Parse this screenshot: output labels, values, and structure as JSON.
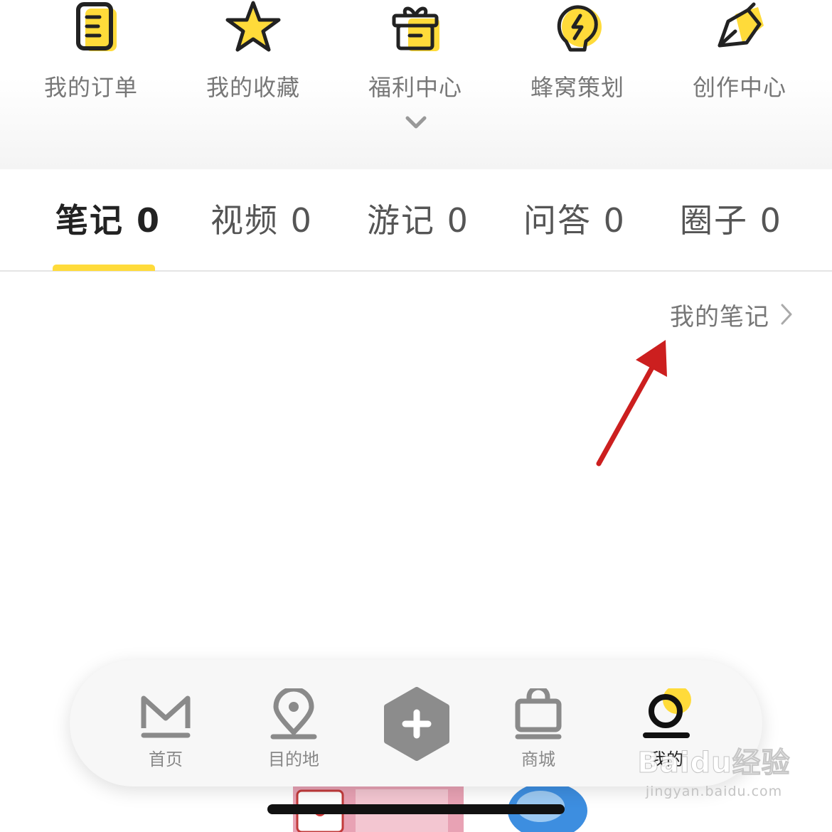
{
  "quick_menu": {
    "items": [
      {
        "label": "我的订单",
        "icon": "order-icon"
      },
      {
        "label": "我的收藏",
        "icon": "star-icon"
      },
      {
        "label": "福利中心",
        "icon": "gift-icon"
      },
      {
        "label": "蜂窝策划",
        "icon": "bulb-icon"
      },
      {
        "label": "创作中心",
        "icon": "pen-icon"
      }
    ],
    "expand_icon": "chevron-down-icon"
  },
  "tabs": [
    {
      "label": "笔记 0",
      "active": true
    },
    {
      "label": "视频 0",
      "active": false
    },
    {
      "label": "游记 0",
      "active": false
    },
    {
      "label": "问答 0",
      "active": false
    },
    {
      "label": "圈子 0",
      "active": false
    }
  ],
  "my_notes": {
    "label": "我的笔记",
    "icon": "chevron-right-icon"
  },
  "bottom_nav": {
    "items": [
      {
        "label": "首页",
        "icon": "home-m-icon",
        "active": false
      },
      {
        "label": "目的地",
        "icon": "location-pin-icon",
        "active": false
      },
      {
        "label": "商城",
        "icon": "shopping-bag-icon",
        "active": false
      },
      {
        "label": "我的",
        "icon": "profile-icon",
        "active": true
      }
    ],
    "add_icon": "add-hexagon-icon"
  },
  "watermark": {
    "brand": "Baidu经验",
    "url": "jingyan.baidu.com"
  },
  "colors": {
    "accent": "#ffdb3a",
    "annotation": "#cc1f1f",
    "muted_icon": "#8a8a8a",
    "active_text": "#222222"
  }
}
